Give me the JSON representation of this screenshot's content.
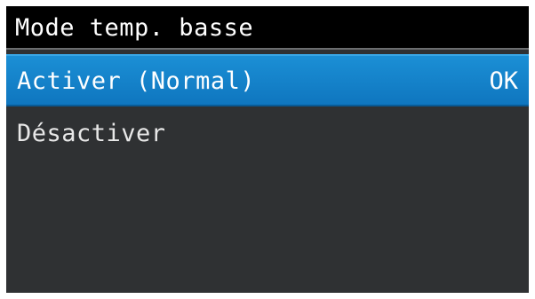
{
  "title": "Mode temp. basse",
  "menu": {
    "items": [
      {
        "label": "Activer (Normal)",
        "status": "OK",
        "selected": true
      },
      {
        "label": "Désactiver",
        "status": "",
        "selected": false
      }
    ]
  },
  "colors": {
    "title_bar_bg": "#000000",
    "screen_bg": "#2f3133",
    "selected_item_bg": "#1486cc",
    "text": "#ffffff"
  }
}
